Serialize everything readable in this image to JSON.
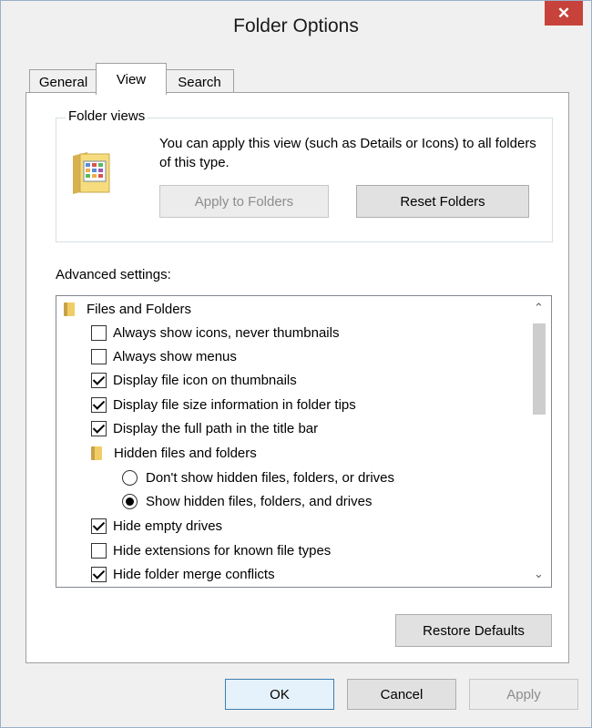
{
  "window": {
    "title": "Folder Options",
    "close_glyph": "✕"
  },
  "tabs": [
    {
      "label": "General",
      "active": false
    },
    {
      "label": "View",
      "active": true
    },
    {
      "label": "Search",
      "active": false
    }
  ],
  "folder_views": {
    "legend": "Folder views",
    "description": "You can apply this view (such as Details or Icons) to all folders of this type.",
    "apply_label": "Apply to Folders",
    "reset_label": "Reset Folders",
    "icon": "folder-view-icon"
  },
  "advanced": {
    "label": "Advanced settings:",
    "items": [
      {
        "type": "folder",
        "label": "Files and Folders"
      },
      {
        "type": "checkbox",
        "label": "Always show icons, never thumbnails",
        "checked": false
      },
      {
        "type": "checkbox",
        "label": "Always show menus",
        "checked": false
      },
      {
        "type": "checkbox",
        "label": "Display file icon on thumbnails",
        "checked": true
      },
      {
        "type": "checkbox",
        "label": "Display file size information in folder tips",
        "checked": true
      },
      {
        "type": "checkbox",
        "label": "Display the full path in the title bar",
        "checked": true
      },
      {
        "type": "folder",
        "label": "Hidden files and folders"
      },
      {
        "type": "radio",
        "label": "Don't show hidden files, folders, or drives",
        "selected": false
      },
      {
        "type": "radio",
        "label": "Show hidden files, folders, and drives",
        "selected": true
      },
      {
        "type": "checkbox",
        "label": "Hide empty drives",
        "checked": true
      },
      {
        "type": "checkbox",
        "label": "Hide extensions for known file types",
        "checked": false
      },
      {
        "type": "checkbox",
        "label": "Hide folder merge conflicts",
        "checked": true
      }
    ],
    "restore_label": "Restore Defaults",
    "scroll_up_glyph": "⌃",
    "scroll_down_glyph": "⌄"
  },
  "footer": {
    "ok_label": "OK",
    "cancel_label": "Cancel",
    "apply_label": "Apply"
  },
  "colors": {
    "close_button": "#c7423a",
    "default_button_border": "#3c7fb1"
  }
}
